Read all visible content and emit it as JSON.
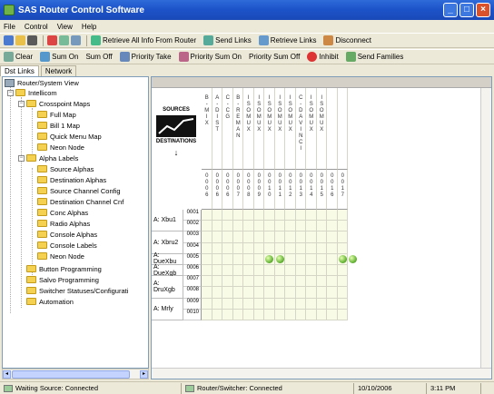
{
  "window": {
    "title": "SAS Router Control Software",
    "minimize": "_",
    "maximize": "□",
    "close": "×"
  },
  "menu": [
    "File",
    "Control",
    "View",
    "Help"
  ],
  "toolbar1": {
    "retrieve_all": "Retrieve All Info From Router",
    "send_links": "Send Links",
    "retrieve_links": "Retrieve Links",
    "disconnect": "Disconnect"
  },
  "toolbar2": {
    "clear": "Clear",
    "sum_on": "Sum On",
    "sum_off": "Sum Off",
    "priority_take": "Priority Take",
    "priority_sum_on": "Priority Sum On",
    "priority_sum_off": "Priority Sum Off",
    "inhibit": "Inhibit",
    "send_families": "Send Families"
  },
  "tabs": [
    "Dst Links",
    "Network"
  ],
  "tree": {
    "root": "Router/System View",
    "nodes": [
      {
        "label": "Intellicom",
        "level": 1
      },
      {
        "label": "Crosspoint Maps",
        "level": 2
      },
      {
        "label": "Full Map",
        "level": 3
      },
      {
        "label": "Bill 1 Map",
        "level": 3
      },
      {
        "label": "Quick Menu Map",
        "level": 3
      },
      {
        "label": "Neon Node",
        "level": 3
      },
      {
        "label": "Alpha Labels",
        "level": 2
      },
      {
        "label": "Source Alphas",
        "level": 3
      },
      {
        "label": "Destination Alphas",
        "level": 3
      },
      {
        "label": "Source Channel Config",
        "level": 3
      },
      {
        "label": "Destination Channel Cnf",
        "level": 3
      },
      {
        "label": "Conc Alphas",
        "level": 3
      },
      {
        "label": "Radio Alphas",
        "level": 3
      },
      {
        "label": "Console Alphas",
        "level": 3
      },
      {
        "label": "Console Labels",
        "level": 3
      },
      {
        "label": "Neon Node",
        "level": 3
      },
      {
        "label": "Button Programming",
        "level": 2
      },
      {
        "label": "Salvo Programming",
        "level": 2
      },
      {
        "label": "Switcher Statuses/Configurati",
        "level": 2
      },
      {
        "label": "Automation",
        "level": 2
      }
    ]
  },
  "matrix": {
    "logo_top": "SOURCES",
    "logo_bottom": "DESTINATIONS",
    "columns": [
      "B-MIX",
      "A-DIST",
      "C-CG",
      "B-REMAN",
      "ISOMUX",
      "ISOMUX",
      "ISOMUX",
      "ISOMUX",
      "ISOMUX",
      "C-DAVINCI",
      "ISOMUX",
      "ISOMUX"
    ],
    "column_codes": [
      "0006",
      "0006",
      "0006",
      "0007",
      "0008",
      "0009",
      "0010",
      "0011",
      "0012",
      "0013",
      "0014",
      "0015",
      "0016",
      "0017"
    ],
    "row_groups": [
      {
        "label": "A: Xbu1",
        "rows": [
          "0001",
          "0002"
        ]
      },
      {
        "label": "A: Xbru2",
        "rows": [
          "0003",
          "0004"
        ]
      },
      {
        "label": "A: DueXbu",
        "rows": [
          "0005"
        ]
      },
      {
        "label": "A: DueXgb",
        "rows": [
          "0006"
        ]
      },
      {
        "label": "A: DruXgb",
        "rows": [
          "0007",
          "0008"
        ]
      },
      {
        "label": "A: Mrly",
        "rows": [
          "0009",
          "0010"
        ]
      }
    ],
    "crosspoints": [
      {
        "row": 4,
        "col": 6
      },
      {
        "row": 4,
        "col": 7
      },
      {
        "row": 4,
        "col": 13
      },
      {
        "row": 4,
        "col": 14
      }
    ]
  },
  "status": {
    "left": "Waiting Source: Connected",
    "middle": "Router/Switcher: Connected",
    "date": "10/10/2006",
    "time": "3:11 PM"
  },
  "colors": {
    "title": "#1d54c9",
    "folder": "#f5d152",
    "crosspoint": "#6ab83a"
  }
}
